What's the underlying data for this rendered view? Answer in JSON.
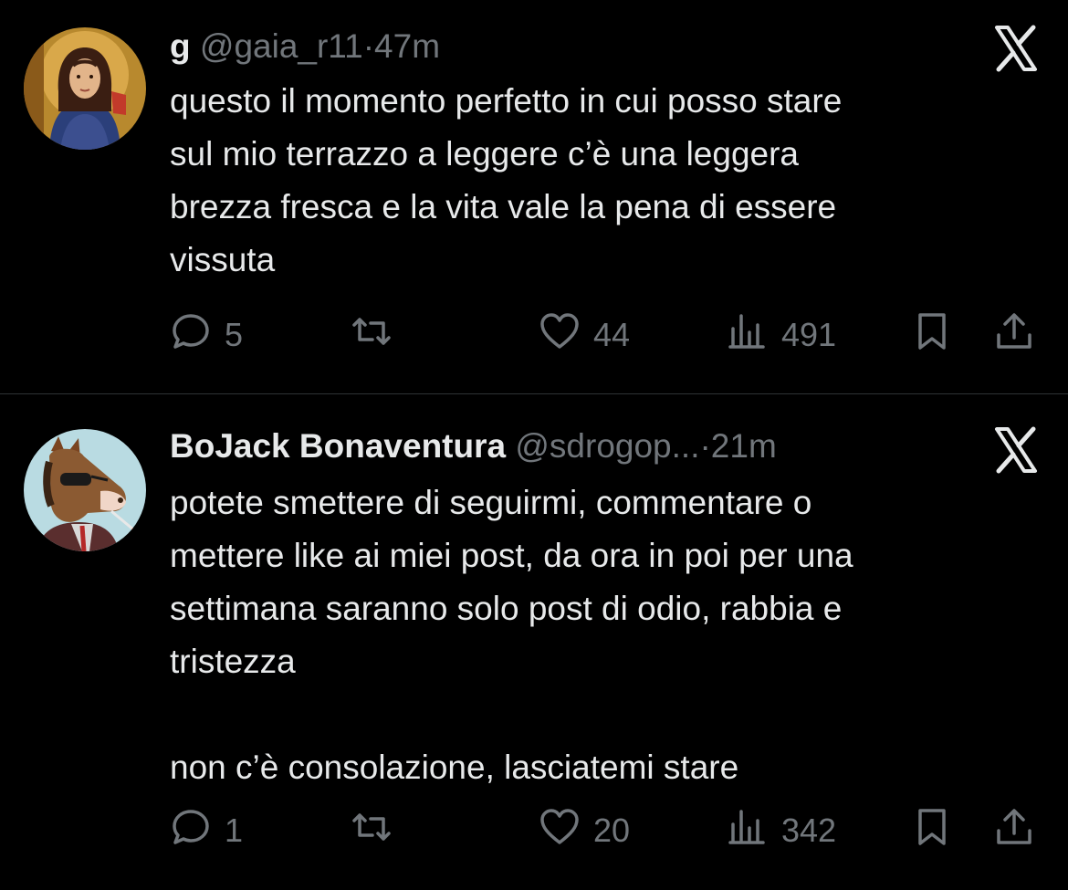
{
  "tweets": [
    {
      "display_name": "g",
      "handle": "@gaia_r11",
      "separator": "·",
      "time": "47m",
      "text": "questo il momento perfetto in cui posso stare\nsul mio terrazzo a leggere c’è una leggera\nbrezza fresca e la vita vale la pena di essere\nvissuta",
      "replies": "5",
      "likes": "44",
      "views": "491"
    },
    {
      "display_name": "BoJack Bonaventura",
      "handle": "@sdrogop...",
      "separator": "·",
      "time": "21m",
      "text": "potete smettere di seguirmi, commentare o\nmettere like ai miei post, da ora in poi per una\nsettimana saranno solo post di odio, rabbia e\ntristezza\n\nnon c’è consolazione, lasciatemi stare",
      "replies": "1",
      "likes": "20",
      "views": "342"
    }
  ],
  "colors": {
    "background": "#000000",
    "text": "#e7e9ea",
    "secondary": "#71767b",
    "divider": "#2f3336"
  },
  "icons": [
    "reply-icon",
    "retweet-icon",
    "like-icon",
    "views-icon",
    "bookmark-icon",
    "share-icon",
    "x-logo-icon"
  ]
}
